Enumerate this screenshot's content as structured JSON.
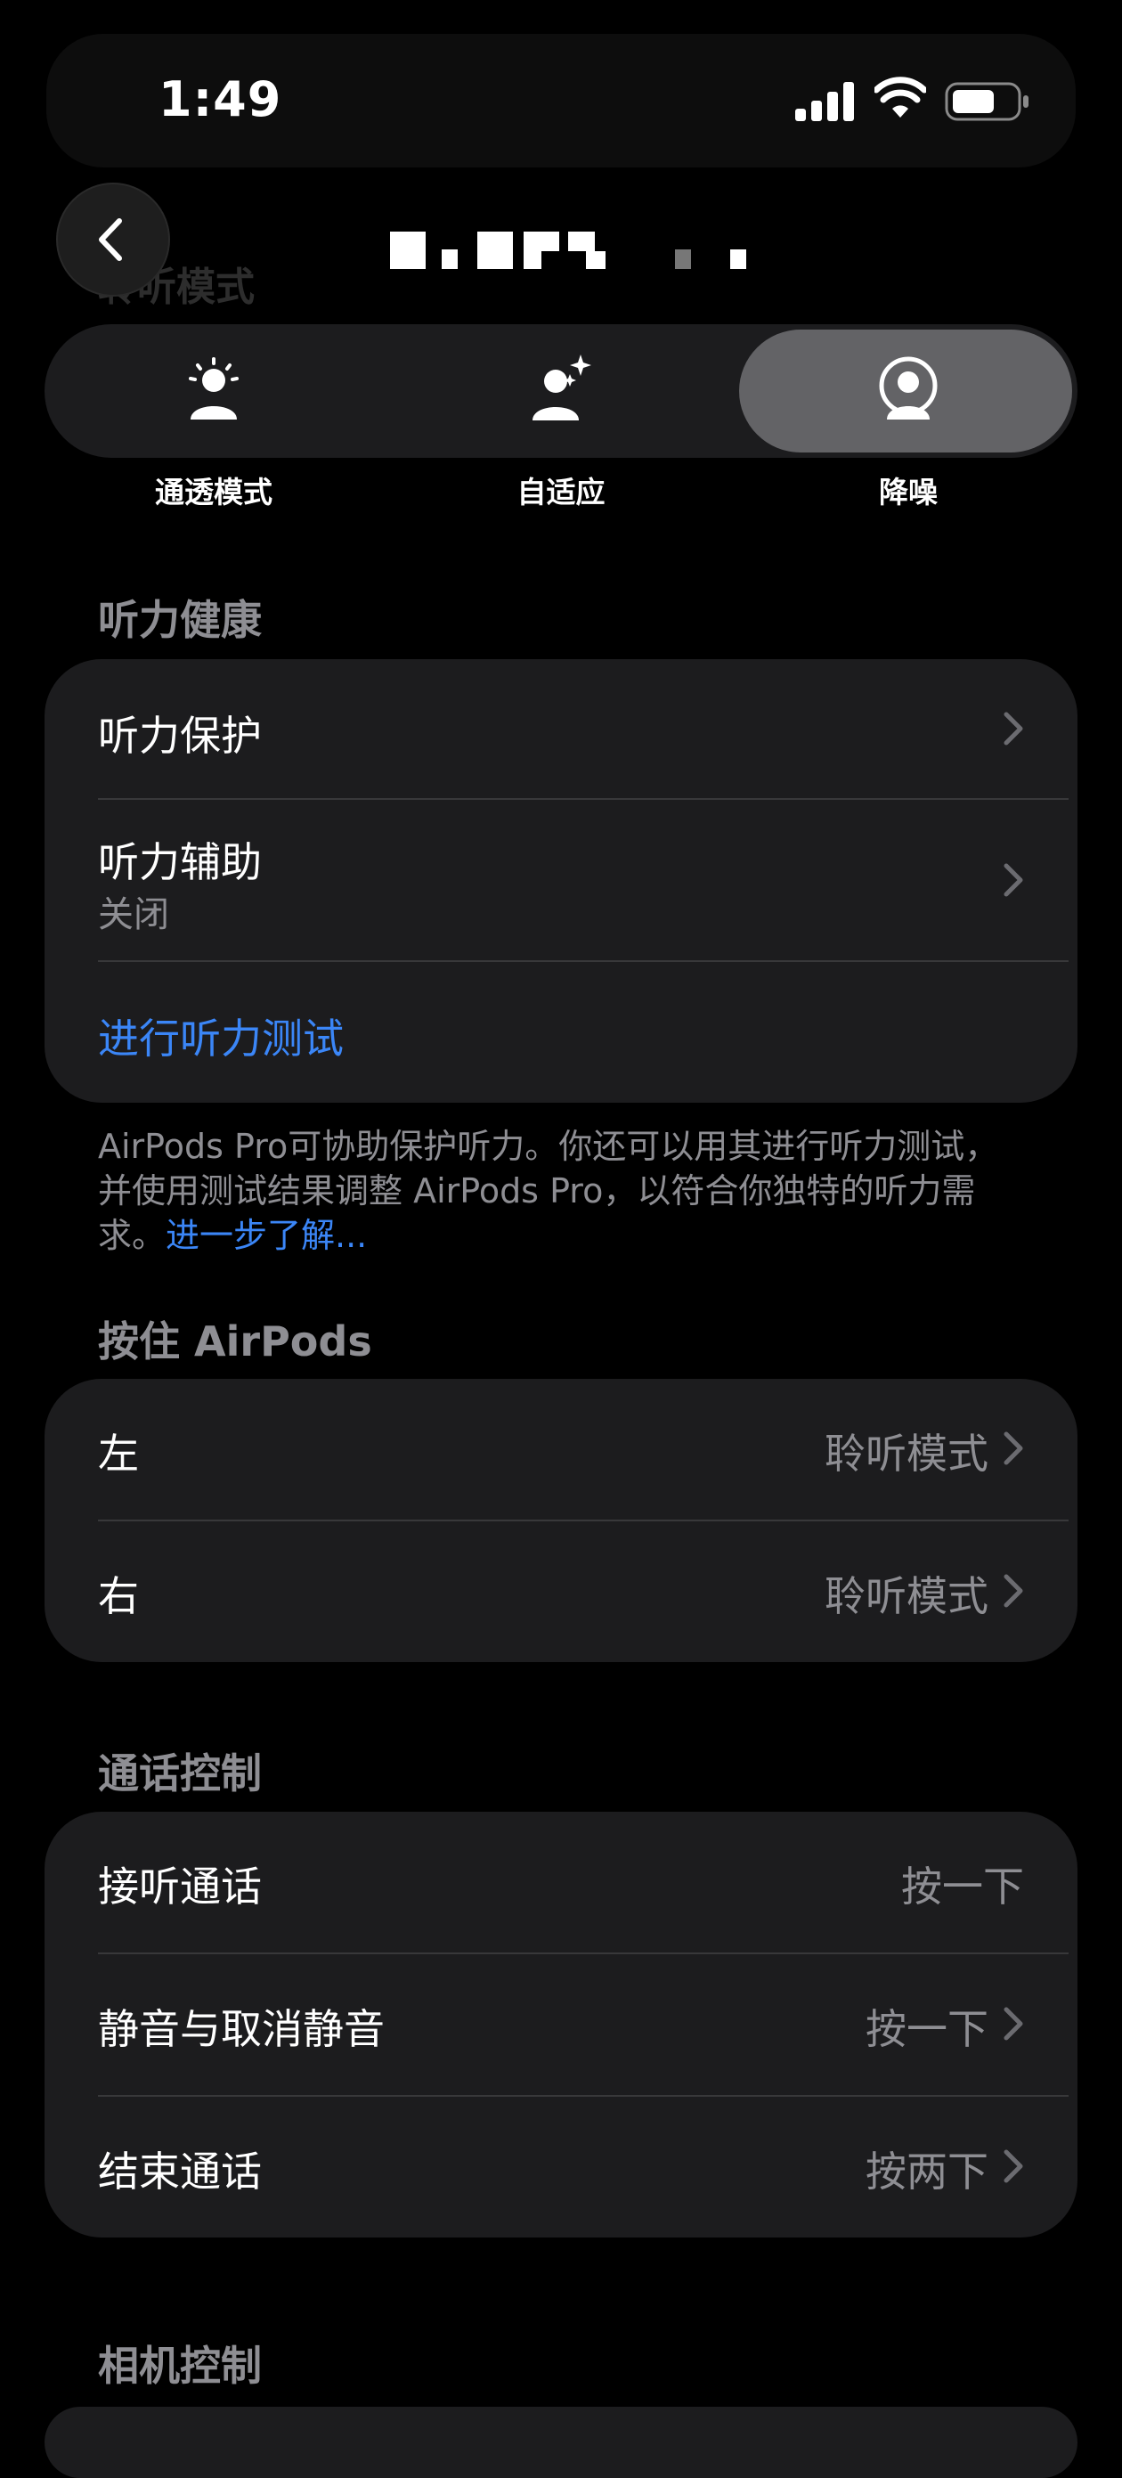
{
  "status_bar": {
    "time": "1:49"
  },
  "header": {
    "title_obscured": true,
    "faded_title": "聆听模式"
  },
  "modes": [
    {
      "label": "通透模式",
      "icon": "transparency-person-icon",
      "selected": false
    },
    {
      "label": "自适应",
      "icon": "adaptive-person-sparkle-icon",
      "selected": false
    },
    {
      "label": "降噪",
      "icon": "noise-cancellation-person-icon",
      "selected": true
    }
  ],
  "hearing_health": {
    "header": "听力健康",
    "protection": "听力保护",
    "assist_title": "听力辅助",
    "assist_value": "关闭",
    "test_link": "进行听力测试",
    "footnote": "AirPods Pro可协助保护听力。你还可以用其进行听力测试，并使用测试结果调整 AirPods Pro，以符合你独特的听力需求。",
    "learn_more": "进一步了解..."
  },
  "press_hold": {
    "header": "按住 AirPods",
    "left_label": "左",
    "left_value": "聆听模式",
    "right_label": "右",
    "right_value": "聆听模式"
  },
  "call_controls": {
    "header": "通话控制",
    "answer_label": "接听通话",
    "answer_value": "按一下",
    "mute_label": "静音与取消静音",
    "mute_value": "按一下",
    "end_label": "结束通话",
    "end_value": "按两下"
  },
  "camera_controls": {
    "header": "相机控制"
  },
  "colors": {
    "accent": "#3b86f7",
    "group_bg": "#1c1c1e",
    "secondary_text": "#8e8e93"
  }
}
